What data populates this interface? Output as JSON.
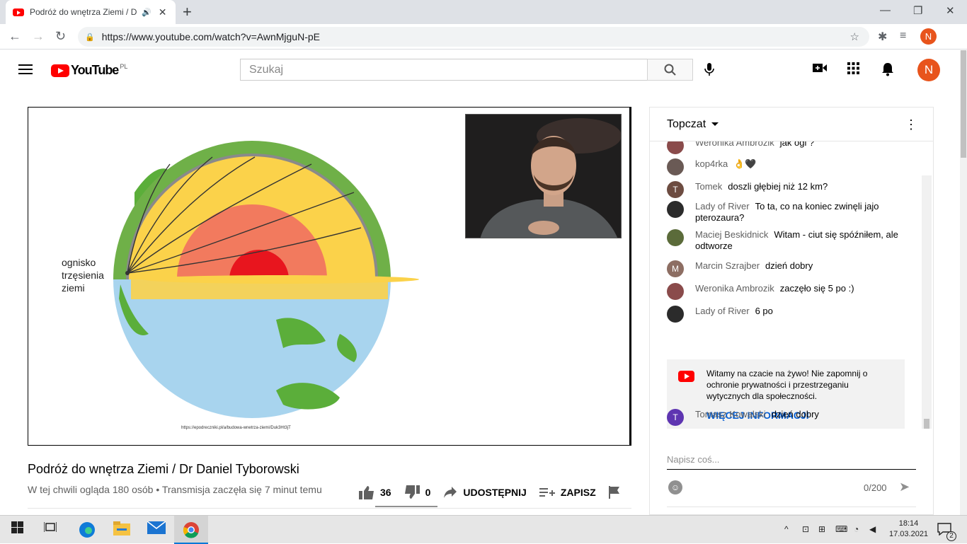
{
  "browser": {
    "tab_title": "Podróż do wnętrza Ziemi / D",
    "new_tab": "+",
    "url": "https://www.youtube.com/watch?v=AwnMjguN-pE",
    "profile_initial": "N",
    "window_min": "—",
    "window_max": "❐",
    "window_close": "✕"
  },
  "youtube": {
    "logo_text": "YouTube",
    "country": "PL",
    "search_placeholder": "Szukaj",
    "avatar_initial": "N"
  },
  "video": {
    "label_lines": [
      "ognisko",
      "trzęsienia",
      "ziemi"
    ],
    "credit": "https://epodreczniki.pl/a/budowa-wnetrza-ziemi/Duk3Ht3jT",
    "title": "Podróż do wnętrza Ziemi / Dr Daniel Tyborowski",
    "meta": "W tej chwili ogląda 180 osób • Transmisja zaczęła się 7 minut temu",
    "likes": "36",
    "dislikes": "0",
    "share": "UDOSTĘPNIJ",
    "save": "ZAPISZ"
  },
  "chat": {
    "header": "Topczat",
    "messages": [
      {
        "name": "Weronika Ambrozik",
        "text": "jak ogi ?",
        "initial": "",
        "color": "#8a4b4b"
      },
      {
        "name": "kop4rka",
        "text": "👌🖤",
        "initial": "",
        "color": "#6a5a55"
      },
      {
        "name": "Tomek",
        "text": "doszli głębiej niż 12 km?",
        "initial": "T",
        "color": "#6d4c41"
      },
      {
        "name": "Lady of River",
        "text": "To ta, co na koniec zwinęli jajo pterozaura?",
        "initial": "",
        "color": "#2b2b2b"
      },
      {
        "name": "Maciej Beskidnick",
        "text": "Witam - ciut się spóźniłem, ale odtworze",
        "initial": "",
        "color": "#5b6b3a"
      },
      {
        "name": "Marcin Szrajber",
        "text": "dzień dobry",
        "initial": "M",
        "color": "#8d6e63"
      },
      {
        "name": "Weronika Ambrozik",
        "text": "zaczęło się 5 po :)",
        "initial": "",
        "color": "#8a4b4b"
      },
      {
        "name": "Lady of River",
        "text": "6 po",
        "initial": "",
        "color": "#2b2b2b"
      },
      {
        "name": "Tomasz Kowalski",
        "text": "dzień dobry",
        "initial": "T",
        "color": "#5e35b1"
      }
    ],
    "banner_text": "Witamy na czacie na żywo! Nie zapomnij o ochronie prywatności i przestrzeganiu wytycznych dla społeczności.",
    "banner_link": "WIĘCEJ INFORMACJI",
    "input_placeholder": "Napisz coś...",
    "char_count": "0/200"
  },
  "taskbar": {
    "time": "18:14",
    "date": "17.03.2021",
    "notifications": "2"
  }
}
